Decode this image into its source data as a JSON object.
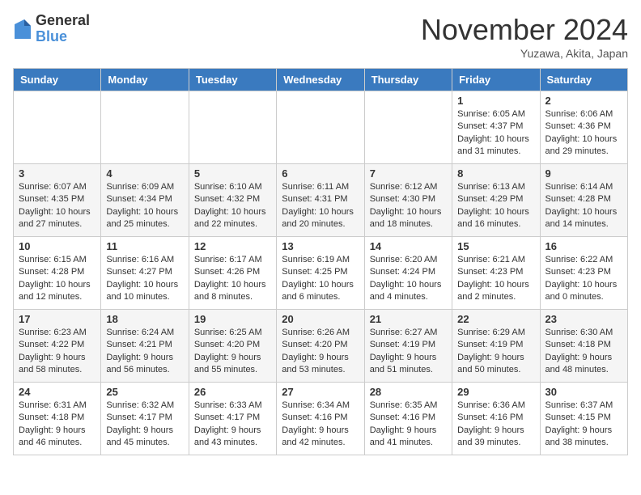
{
  "logo": {
    "general": "General",
    "blue": "Blue"
  },
  "title": "November 2024",
  "subtitle": "Yuzawa, Akita, Japan",
  "days_of_week": [
    "Sunday",
    "Monday",
    "Tuesday",
    "Wednesday",
    "Thursday",
    "Friday",
    "Saturday"
  ],
  "weeks": [
    [
      {
        "day": "",
        "info": ""
      },
      {
        "day": "",
        "info": ""
      },
      {
        "day": "",
        "info": ""
      },
      {
        "day": "",
        "info": ""
      },
      {
        "day": "",
        "info": ""
      },
      {
        "day": "1",
        "info": "Sunrise: 6:05 AM\nSunset: 4:37 PM\nDaylight: 10 hours and 31 minutes."
      },
      {
        "day": "2",
        "info": "Sunrise: 6:06 AM\nSunset: 4:36 PM\nDaylight: 10 hours and 29 minutes."
      }
    ],
    [
      {
        "day": "3",
        "info": "Sunrise: 6:07 AM\nSunset: 4:35 PM\nDaylight: 10 hours and 27 minutes."
      },
      {
        "day": "4",
        "info": "Sunrise: 6:09 AM\nSunset: 4:34 PM\nDaylight: 10 hours and 25 minutes."
      },
      {
        "day": "5",
        "info": "Sunrise: 6:10 AM\nSunset: 4:32 PM\nDaylight: 10 hours and 22 minutes."
      },
      {
        "day": "6",
        "info": "Sunrise: 6:11 AM\nSunset: 4:31 PM\nDaylight: 10 hours and 20 minutes."
      },
      {
        "day": "7",
        "info": "Sunrise: 6:12 AM\nSunset: 4:30 PM\nDaylight: 10 hours and 18 minutes."
      },
      {
        "day": "8",
        "info": "Sunrise: 6:13 AM\nSunset: 4:29 PM\nDaylight: 10 hours and 16 minutes."
      },
      {
        "day": "9",
        "info": "Sunrise: 6:14 AM\nSunset: 4:28 PM\nDaylight: 10 hours and 14 minutes."
      }
    ],
    [
      {
        "day": "10",
        "info": "Sunrise: 6:15 AM\nSunset: 4:28 PM\nDaylight: 10 hours and 12 minutes."
      },
      {
        "day": "11",
        "info": "Sunrise: 6:16 AM\nSunset: 4:27 PM\nDaylight: 10 hours and 10 minutes."
      },
      {
        "day": "12",
        "info": "Sunrise: 6:17 AM\nSunset: 4:26 PM\nDaylight: 10 hours and 8 minutes."
      },
      {
        "day": "13",
        "info": "Sunrise: 6:19 AM\nSunset: 4:25 PM\nDaylight: 10 hours and 6 minutes."
      },
      {
        "day": "14",
        "info": "Sunrise: 6:20 AM\nSunset: 4:24 PM\nDaylight: 10 hours and 4 minutes."
      },
      {
        "day": "15",
        "info": "Sunrise: 6:21 AM\nSunset: 4:23 PM\nDaylight: 10 hours and 2 minutes."
      },
      {
        "day": "16",
        "info": "Sunrise: 6:22 AM\nSunset: 4:23 PM\nDaylight: 10 hours and 0 minutes."
      }
    ],
    [
      {
        "day": "17",
        "info": "Sunrise: 6:23 AM\nSunset: 4:22 PM\nDaylight: 9 hours and 58 minutes."
      },
      {
        "day": "18",
        "info": "Sunrise: 6:24 AM\nSunset: 4:21 PM\nDaylight: 9 hours and 56 minutes."
      },
      {
        "day": "19",
        "info": "Sunrise: 6:25 AM\nSunset: 4:20 PM\nDaylight: 9 hours and 55 minutes."
      },
      {
        "day": "20",
        "info": "Sunrise: 6:26 AM\nSunset: 4:20 PM\nDaylight: 9 hours and 53 minutes."
      },
      {
        "day": "21",
        "info": "Sunrise: 6:27 AM\nSunset: 4:19 PM\nDaylight: 9 hours and 51 minutes."
      },
      {
        "day": "22",
        "info": "Sunrise: 6:29 AM\nSunset: 4:19 PM\nDaylight: 9 hours and 50 minutes."
      },
      {
        "day": "23",
        "info": "Sunrise: 6:30 AM\nSunset: 4:18 PM\nDaylight: 9 hours and 48 minutes."
      }
    ],
    [
      {
        "day": "24",
        "info": "Sunrise: 6:31 AM\nSunset: 4:18 PM\nDaylight: 9 hours and 46 minutes."
      },
      {
        "day": "25",
        "info": "Sunrise: 6:32 AM\nSunset: 4:17 PM\nDaylight: 9 hours and 45 minutes."
      },
      {
        "day": "26",
        "info": "Sunrise: 6:33 AM\nSunset: 4:17 PM\nDaylight: 9 hours and 43 minutes."
      },
      {
        "day": "27",
        "info": "Sunrise: 6:34 AM\nSunset: 4:16 PM\nDaylight: 9 hours and 42 minutes."
      },
      {
        "day": "28",
        "info": "Sunrise: 6:35 AM\nSunset: 4:16 PM\nDaylight: 9 hours and 41 minutes."
      },
      {
        "day": "29",
        "info": "Sunrise: 6:36 AM\nSunset: 4:16 PM\nDaylight: 9 hours and 39 minutes."
      },
      {
        "day": "30",
        "info": "Sunrise: 6:37 AM\nSunset: 4:15 PM\nDaylight: 9 hours and 38 minutes."
      }
    ]
  ]
}
